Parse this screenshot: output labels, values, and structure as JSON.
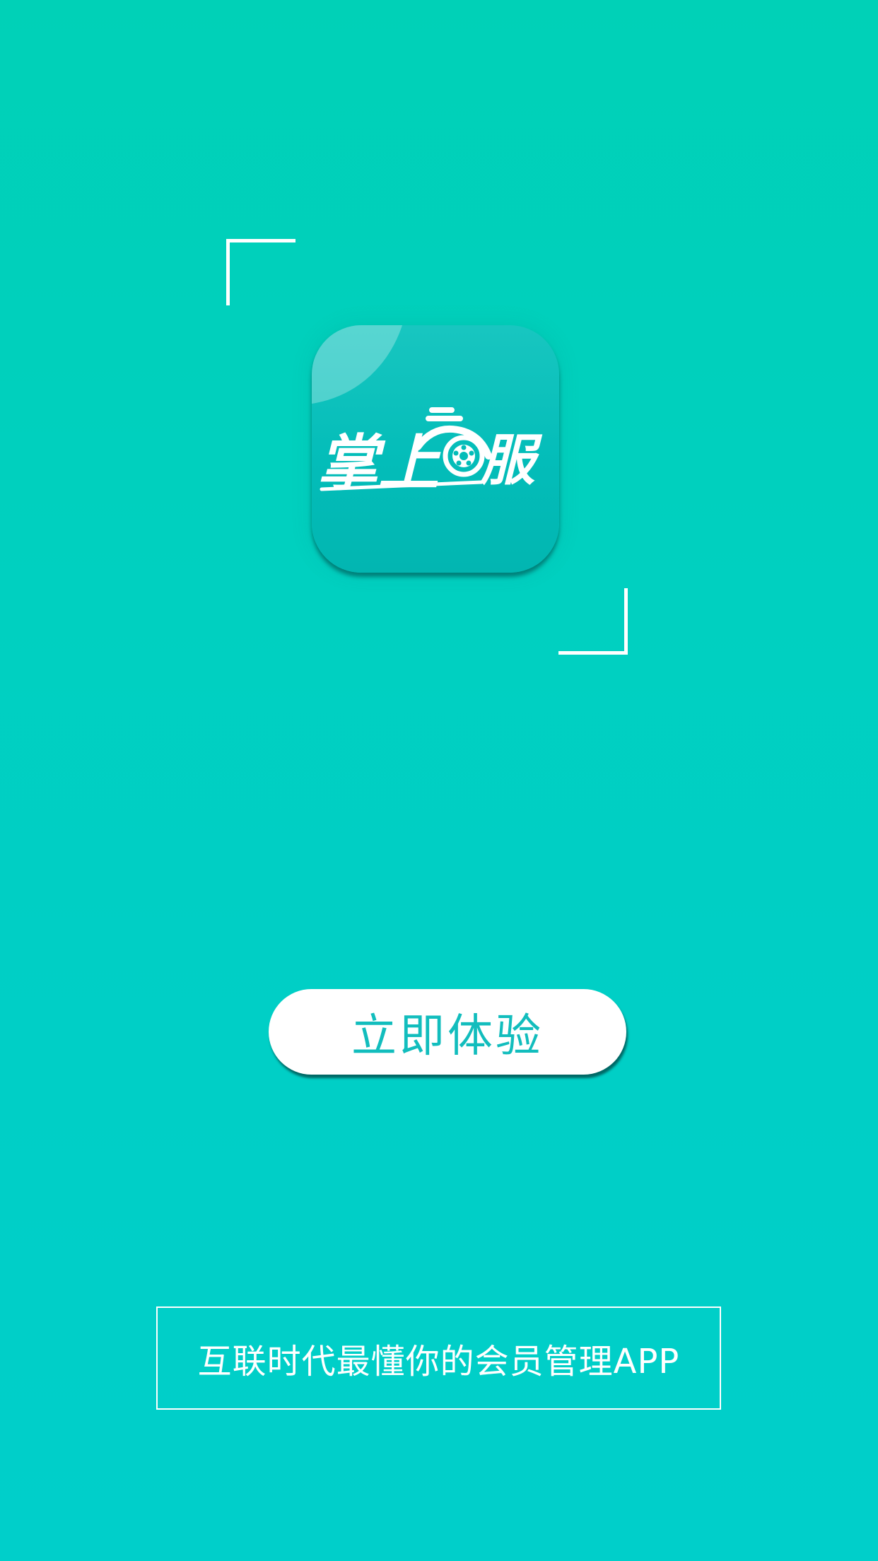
{
  "app": {
    "logo_text_left": "掌上",
    "logo_text_right": "服",
    "logo_car_glyph": "汽"
  },
  "cta": {
    "label": "立即体验"
  },
  "slogan": {
    "text": "互联时代最懂你的会员管理APP"
  },
  "colors": {
    "background": "#00d1b7",
    "icon": "#03bdb9",
    "button_text": "#12bdbd",
    "white": "#ffffff"
  }
}
